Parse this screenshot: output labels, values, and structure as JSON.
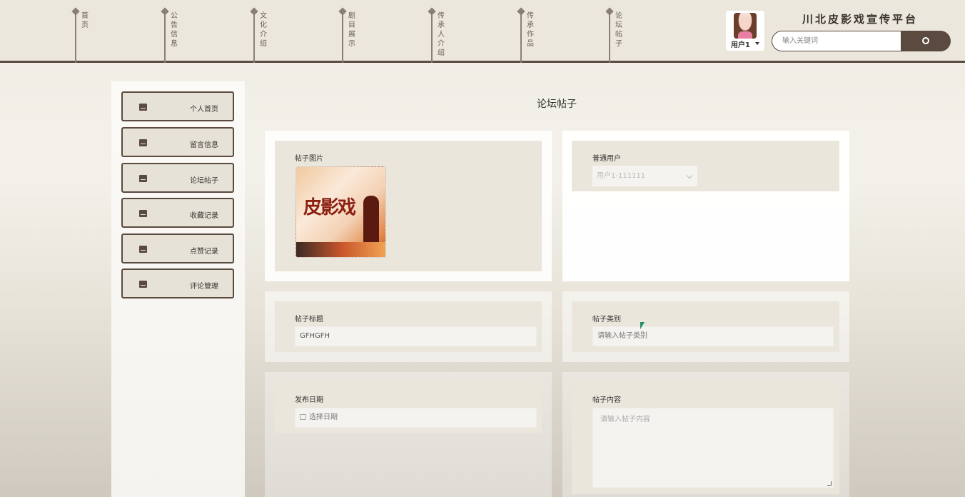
{
  "header": {
    "nav": [
      {
        "label": "首页"
      },
      {
        "label": "公告信息"
      },
      {
        "label": "文化介绍"
      },
      {
        "label": "剧目展示"
      },
      {
        "label": "传承人介绍"
      },
      {
        "label": "传承作品"
      },
      {
        "label": "论坛帖子"
      }
    ],
    "user_label": "用户1",
    "site_title": "川北皮影戏宣传平台",
    "search_placeholder": "输入关键词"
  },
  "sidebar": {
    "items": [
      {
        "label": "个人首页"
      },
      {
        "label": "留言信息"
      },
      {
        "label": "论坛帖子"
      },
      {
        "label": "收藏记录"
      },
      {
        "label": "点赞记录"
      },
      {
        "label": "评论管理"
      }
    ]
  },
  "main": {
    "title": "论坛帖子",
    "image_field": {
      "label": "帖子图片",
      "poster_text": "皮影戏"
    },
    "user_field": {
      "label": "普通用户",
      "value": "用户1-111111"
    },
    "title_field": {
      "label": "帖子标题",
      "value": "GFHGFH"
    },
    "category_field": {
      "label": "帖子类别",
      "placeholder": "请输入帖子类别"
    },
    "date_field": {
      "label": "发布日期",
      "placeholder": "选择日期"
    },
    "content_field": {
      "label": "帖子内容",
      "placeholder": "请输入帖子内容"
    }
  }
}
